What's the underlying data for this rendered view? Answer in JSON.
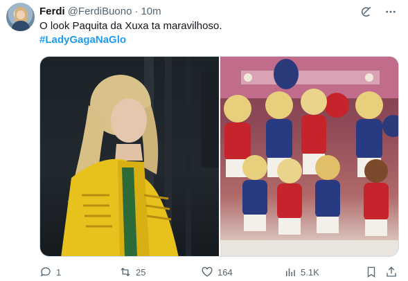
{
  "tweet": {
    "author": {
      "display_name": "Ferdi",
      "handle": "@FerdiBuono"
    },
    "separator": "·",
    "timestamp": "10m",
    "text": "O look Paquita da Xuxa ta maravilhoso.",
    "hashtag": "#LadyGagaNaGlo",
    "media": [
      {
        "icon": "photo-performer-yellow-jacket"
      },
      {
        "icon": "photo-group-red-blue-uniforms"
      }
    ],
    "stats": {
      "replies": "1",
      "reposts": "25",
      "likes": "164",
      "views": "5.1K"
    }
  },
  "colors": {
    "link": "#1d9bf0",
    "secondary_text": "#536471",
    "primary_text": "#0f1419"
  }
}
